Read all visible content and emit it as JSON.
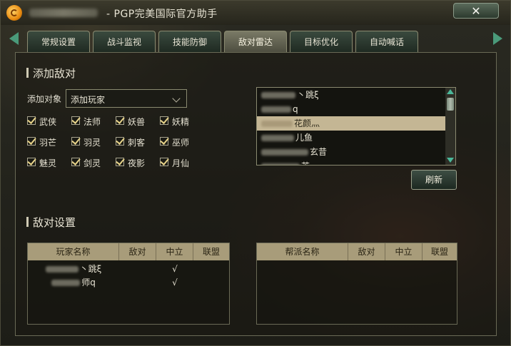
{
  "window": {
    "title": "- PGP完美国际官方助手",
    "close_label": "✕"
  },
  "tabs": [
    {
      "label": "常规设置",
      "active": false
    },
    {
      "label": "战斗监视",
      "active": false
    },
    {
      "label": "技能防御",
      "active": false
    },
    {
      "label": "敌对雷达",
      "active": true
    },
    {
      "label": "目标优化",
      "active": false
    },
    {
      "label": "自动喊话",
      "active": false
    }
  ],
  "add_enemy": {
    "title": "添加敌对",
    "target_label": "添加对象",
    "target_value": "添加玩家",
    "classes": [
      {
        "label": "武侠",
        "checked": true
      },
      {
        "label": "法师",
        "checked": true
      },
      {
        "label": "妖兽",
        "checked": true
      },
      {
        "label": "妖精",
        "checked": true
      },
      {
        "label": "羽芒",
        "checked": true
      },
      {
        "label": "羽灵",
        "checked": true
      },
      {
        "label": "刺客",
        "checked": true
      },
      {
        "label": "巫师",
        "checked": true
      },
      {
        "label": "魅灵",
        "checked": true
      },
      {
        "label": "剑灵",
        "checked": true
      },
      {
        "label": "夜影",
        "checked": true
      },
      {
        "label": "月仙",
        "checked": true
      }
    ],
    "player_list": [
      {
        "text": "丶跳ξ",
        "selected": false
      },
      {
        "text": "q",
        "selected": false
      },
      {
        "text": "花颜灬",
        "selected": true
      },
      {
        "text": "儿鱼",
        "selected": false
      },
      {
        "text": "玄昔",
        "selected": false
      },
      {
        "text": "苦",
        "selected": false
      }
    ],
    "refresh_label": "刷新"
  },
  "enemy_settings": {
    "title": "敌对设置",
    "player_table": {
      "headers": [
        "玩家名称",
        "敌对",
        "中立",
        "联盟"
      ],
      "rows": [
        {
          "name": "丶跳ξ",
          "hostile": "",
          "neutral": "√",
          "alliance": ""
        },
        {
          "name": "师q",
          "hostile": "",
          "neutral": "√",
          "alliance": ""
        }
      ]
    },
    "guild_table": {
      "headers": [
        "帮派名称",
        "敌对",
        "中立",
        "联盟"
      ],
      "rows": []
    }
  }
}
